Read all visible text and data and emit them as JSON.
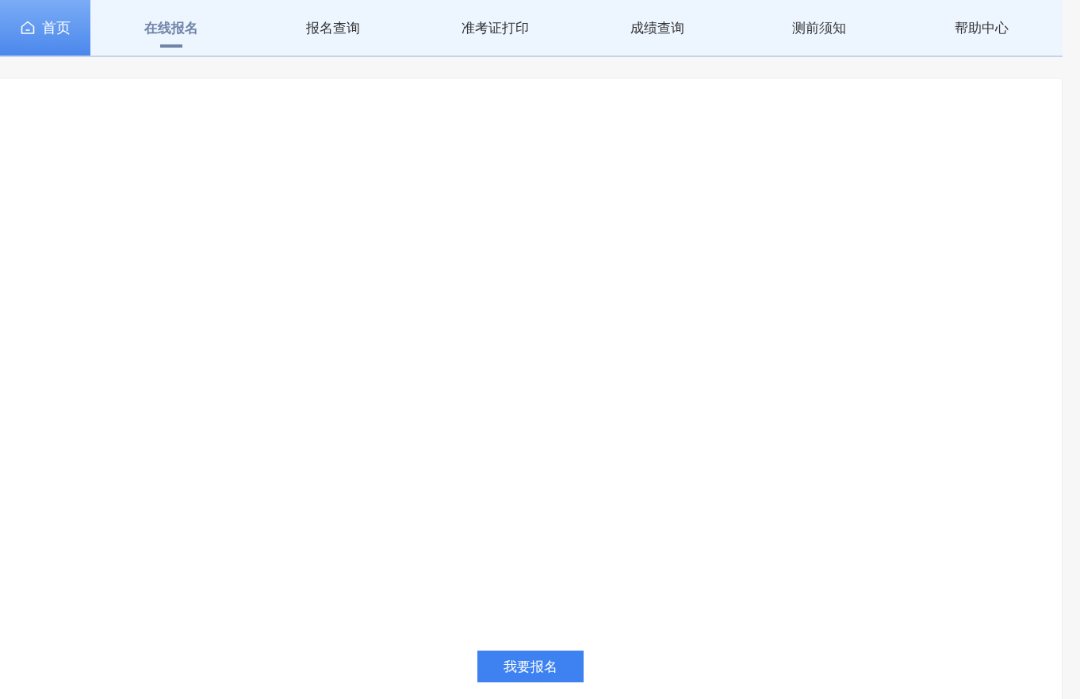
{
  "nav": {
    "home": {
      "label": "首页"
    },
    "tabs": [
      {
        "label": "在线报名",
        "selected": true
      },
      {
        "label": "报名查询",
        "selected": false
      },
      {
        "label": "准考证打印",
        "selected": false
      },
      {
        "label": "成绩查询",
        "selected": false
      },
      {
        "label": "测前须知",
        "selected": false
      },
      {
        "label": "帮助中心",
        "selected": false
      }
    ]
  },
  "content": {
    "action_button": "我要报名"
  }
}
